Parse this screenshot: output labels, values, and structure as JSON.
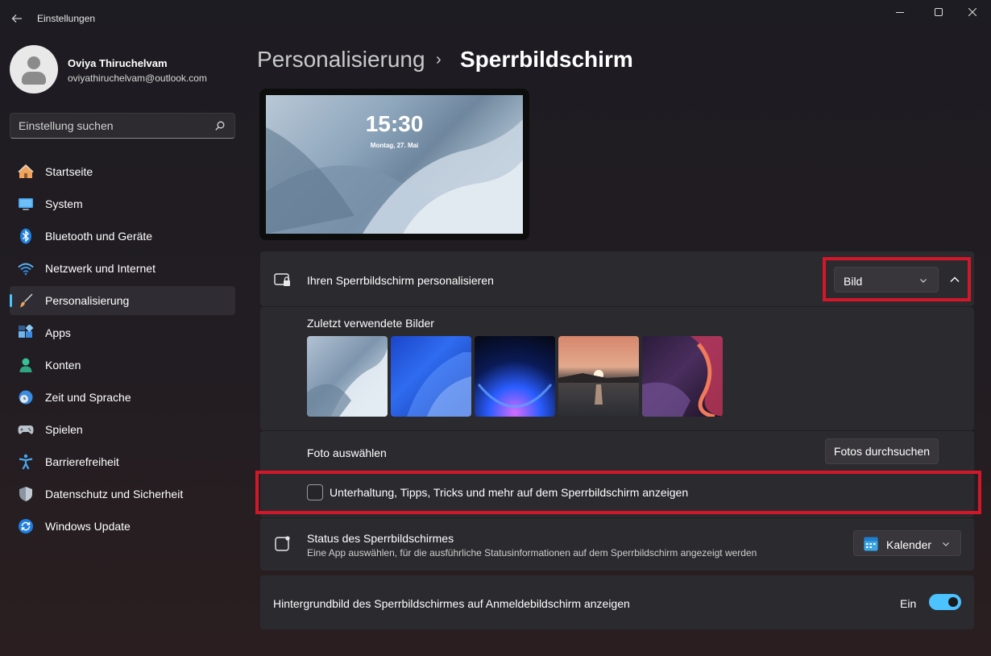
{
  "window": {
    "title": "Einstellungen"
  },
  "user": {
    "name": "Oviya Thiruchelvam",
    "email": "oviyathiruchelvam@outlook.com"
  },
  "search": {
    "placeholder": "Einstellung suchen"
  },
  "sidebar": {
    "items": [
      {
        "label": "Startseite",
        "icon": "home-icon",
        "active": false
      },
      {
        "label": "System",
        "icon": "monitor-icon",
        "active": false
      },
      {
        "label": "Bluetooth und Geräte",
        "icon": "bluetooth-icon",
        "active": false
      },
      {
        "label": "Netzwerk und Internet",
        "icon": "wifi-icon",
        "active": false
      },
      {
        "label": "Personalisierung",
        "icon": "brush-icon",
        "active": true
      },
      {
        "label": "Apps",
        "icon": "apps-icon",
        "active": false
      },
      {
        "label": "Konten",
        "icon": "person-icon",
        "active": false
      },
      {
        "label": "Zeit und Sprache",
        "icon": "clock-globe-icon",
        "active": false
      },
      {
        "label": "Spielen",
        "icon": "gamepad-icon",
        "active": false
      },
      {
        "label": "Barrierefreiheit",
        "icon": "accessibility-icon",
        "active": false
      },
      {
        "label": "Datenschutz und Sicherheit",
        "icon": "shield-icon",
        "active": false
      },
      {
        "label": "Windows Update",
        "icon": "update-icon",
        "active": false
      }
    ]
  },
  "breadcrumb": {
    "parent": "Personalisierung",
    "separator": "›",
    "current": "Sperrbildschirm"
  },
  "preview": {
    "time": "15:30",
    "date": "Montag, 27. Mai"
  },
  "personalize": {
    "label": "Ihren Sperrbildschirm personalisieren",
    "dropdown_value": "Bild",
    "recent_label": "Zuletzt verwendete Bilder",
    "photo_label": "Foto auswählen",
    "browse_button": "Fotos durchsuchen",
    "tips_label": "Unterhaltung, Tipps, Tricks und mehr auf dem Sperrbildschirm anzeigen",
    "tips_checked": false
  },
  "status": {
    "label": "Status des Sperrbildschirmes",
    "description": "Eine App auswählen, für die ausführliche Statusinformationen auf dem Sperrbildschirm angezeigt werden",
    "dropdown_value": "Kalender"
  },
  "signin": {
    "label": "Hintergrundbild des Sperrbildschirmes auf Anmeldebildschirm anzeigen",
    "toggle_state": "Ein",
    "toggle_on": true
  },
  "colors": {
    "accent": "#4cc2ff",
    "highlight": "#d3172a"
  }
}
